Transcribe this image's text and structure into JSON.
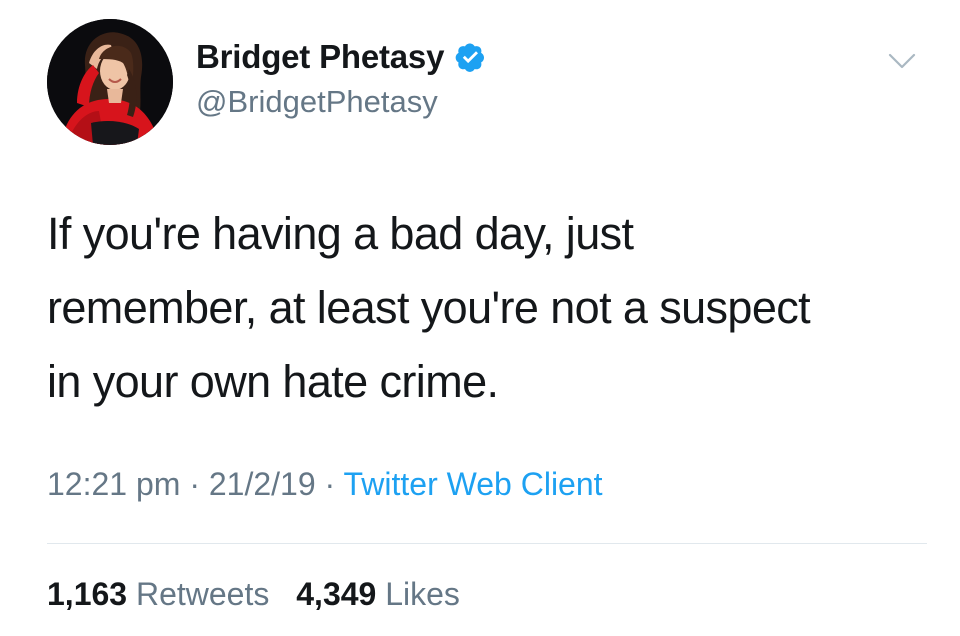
{
  "author": {
    "display_name": "Bridget Phetasy",
    "handle": "@BridgetPhetasy",
    "verified": true,
    "avatar_icon": "profile-photo"
  },
  "tweet": {
    "text_lines": [
      "If you're having a bad day, just",
      "remember, at least you're not a suspect",
      "in your own hate crime."
    ],
    "time": "12:21 pm",
    "date": "21/2/19",
    "separator": "·",
    "source": "Twitter Web Client"
  },
  "stats": {
    "retweets_count": "1,163",
    "retweets_label": "Retweets",
    "likes_count": "4,349",
    "likes_label": "Likes"
  },
  "colors": {
    "text": "#14171a",
    "secondary": "#657786",
    "link": "#1da1f2",
    "verified_badge": "#1da1f2",
    "divider": "#e1e8ed"
  },
  "icons": {
    "verified": "verified-badge-icon",
    "menu": "chevron-down-icon"
  }
}
